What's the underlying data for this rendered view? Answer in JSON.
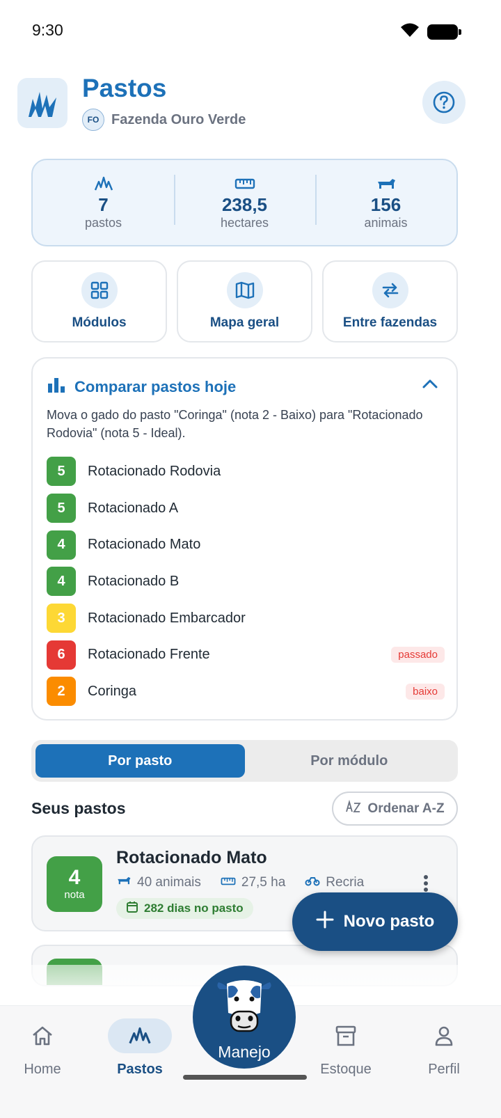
{
  "status_bar": {
    "time": "9:30"
  },
  "header": {
    "title": "Pastos",
    "farm_initials": "FO",
    "farm_name": "Fazenda Ouro Verde"
  },
  "stats": [
    {
      "value": "7",
      "label": "pastos",
      "icon": "grass-icon"
    },
    {
      "value": "238,5",
      "label": "hectares",
      "icon": "ruler-icon"
    },
    {
      "value": "156",
      "label": "animais",
      "icon": "cattle-icon"
    }
  ],
  "actions": [
    {
      "label": "Módulos",
      "icon": "grid-icon"
    },
    {
      "label": "Mapa geral",
      "icon": "map-icon"
    },
    {
      "label": "Entre fazendas",
      "icon": "swap-icon"
    }
  ],
  "compare": {
    "title": "Comparar pastos hoje",
    "recommendation": "Mova o gado do pasto \"Coringa\" (nota 2 - Baixo) para \"Rotacionado Rodovia\" (nota 5 - Ideal).",
    "items": [
      {
        "score": "5",
        "name": "Rotacionado Rodovia",
        "tag": "",
        "color": "#43a047"
      },
      {
        "score": "5",
        "name": "Rotacionado A",
        "tag": "",
        "color": "#43a047"
      },
      {
        "score": "4",
        "name": "Rotacionado Mato",
        "tag": "",
        "color": "#43a047"
      },
      {
        "score": "4",
        "name": "Rotacionado B",
        "tag": "",
        "color": "#43a047"
      },
      {
        "score": "3",
        "name": "Rotacionado Embarcador",
        "tag": "",
        "color": "#fdd835"
      },
      {
        "score": "6",
        "name": "Rotacionado Frente",
        "tag": "passado",
        "color": "#e53935"
      },
      {
        "score": "2",
        "name": "Coringa",
        "tag": "baixo",
        "color": "#fb8c00"
      }
    ]
  },
  "segmented": {
    "option_1": "Por pasto",
    "option_2": "Por módulo",
    "selected": "Por pasto"
  },
  "list": {
    "section_title": "Seus pastos",
    "sort_label": "Ordenar A-Z",
    "pasture": {
      "score": "4",
      "score_label": "nota",
      "name": "Rotacionado Mato",
      "animals": "40 animais",
      "area": "27,5 ha",
      "category": "Recria",
      "days": "282 dias no pasto"
    }
  },
  "fab": {
    "label": "Novo pasto"
  },
  "bottom_nav": {
    "home": "Home",
    "pastos": "Pastos",
    "manejo": "Manejo",
    "estoque": "Estoque",
    "perfil": "Perfil",
    "active": "Pastos"
  },
  "colors": {
    "primary": "#1d71b8",
    "primary_dark": "#1a4f84",
    "green": "#43a047",
    "yellow": "#fdd835",
    "red": "#e53935",
    "orange": "#fb8c00"
  }
}
